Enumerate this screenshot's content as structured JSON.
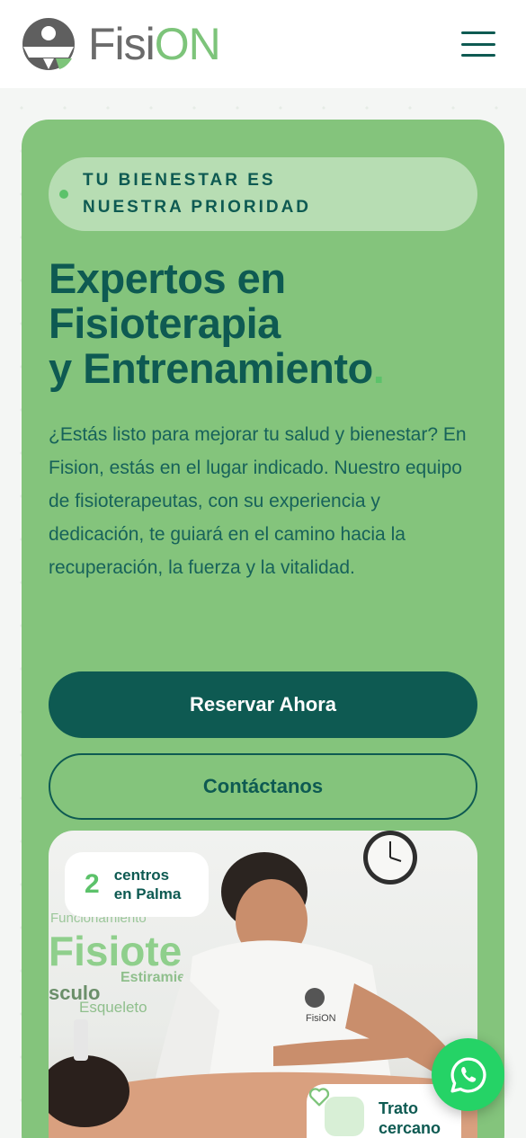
{
  "brand": {
    "name_part1": "Fisi",
    "name_part2": "ON",
    "colors": {
      "dark_green": "#0e5a52",
      "light_green": "#84c47c",
      "accent": "#5cc26a",
      "gray": "#6b6b6b"
    }
  },
  "header": {
    "menu_icon": "hamburger-menu-icon"
  },
  "hero": {
    "tagline": "TU BIENESTAR ES NUESTRA PRIORIDAD",
    "headline_line1": "Expertos en",
    "headline_line2": "Fisioterapia",
    "headline_line3": "y Entrenamiento",
    "headline_dot": ".",
    "description": "¿Estás listo para mejorar tu salud y bienestar? En Fision, estás en el lugar indicado. Nuestro equipo de fisioterapeutas, con su experiencia y dedicación, te guiará en el camino hacia la recuperación, la fuerza y la vitalidad.",
    "primary_button": "Reservar Ahora",
    "secondary_button": "Contáctanos"
  },
  "photo": {
    "wall_text": [
      "Funcionamiento",
      "Fisiote",
      "Estiramie",
      "sculo",
      "Esqueleto"
    ],
    "shirt_logo": "FisiON",
    "stat": {
      "number": "2",
      "label_line1": "centros",
      "label_line2": "en Palma"
    },
    "badge": {
      "icon": "heart-icon",
      "label_line1": "Trato",
      "label_line2": "cercano"
    }
  },
  "floating": {
    "whatsapp_icon": "whatsapp-icon"
  }
}
